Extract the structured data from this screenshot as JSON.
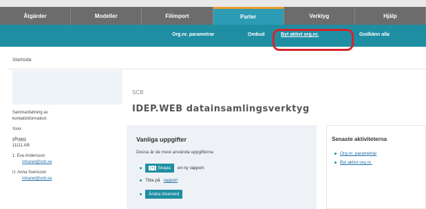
{
  "menu": {
    "items": [
      {
        "label": "Åtgärder"
      },
      {
        "label": "Modeller"
      },
      {
        "label": "Filimport"
      },
      {
        "label": "Parter"
      },
      {
        "label": "Verktyg"
      },
      {
        "label": "Hjälp"
      }
    ],
    "active": "Parter"
  },
  "submenu": {
    "items": [
      {
        "label": "Org.nr. parametrar"
      },
      {
        "label": "Ombud"
      },
      {
        "label": "Byt aktivt org.nr."
      },
      {
        "label": "Godkänn alla"
      }
    ]
  },
  "breadcrumb": "Startsida",
  "sidebar": {
    "heading1": "Sammanfattning av",
    "heading2": "kontaktinformation:",
    "line_a": "Xxxx",
    "line_b": "gfhjggg",
    "line_c": "11111 Alft",
    "contact1_name": "1: Eva Andersson",
    "contact1_email": "intranet@scb.se",
    "contact2_name": "U: Anna Svensson",
    "contact2_email": "intranet@scb.se"
  },
  "org_name": "SCB",
  "app_title": "IDEP.WEB datainsamlingsverktyg",
  "common_tasks": {
    "title": "Vanliga uppgifter",
    "description": "Dessa är de mest använda uppgifterna",
    "create_box": "[+]",
    "create_label": "Skapa",
    "create_suffix": "en ny rapport",
    "view_prefix": "Titta på",
    "view_link": "rapport",
    "change_password": "Ändra lösenord"
  },
  "recent": {
    "title": "Senaste aktiviteterna",
    "items": [
      {
        "label": "Org.nr. parametrar"
      },
      {
        "label": "Byt aktivt org.nr."
      }
    ]
  },
  "colors": {
    "menubar": "#6c6c6c",
    "accent_teal": "#1f8ea3",
    "active_tab_border": "#e89a2e",
    "annotation_red": "#d6232a"
  }
}
